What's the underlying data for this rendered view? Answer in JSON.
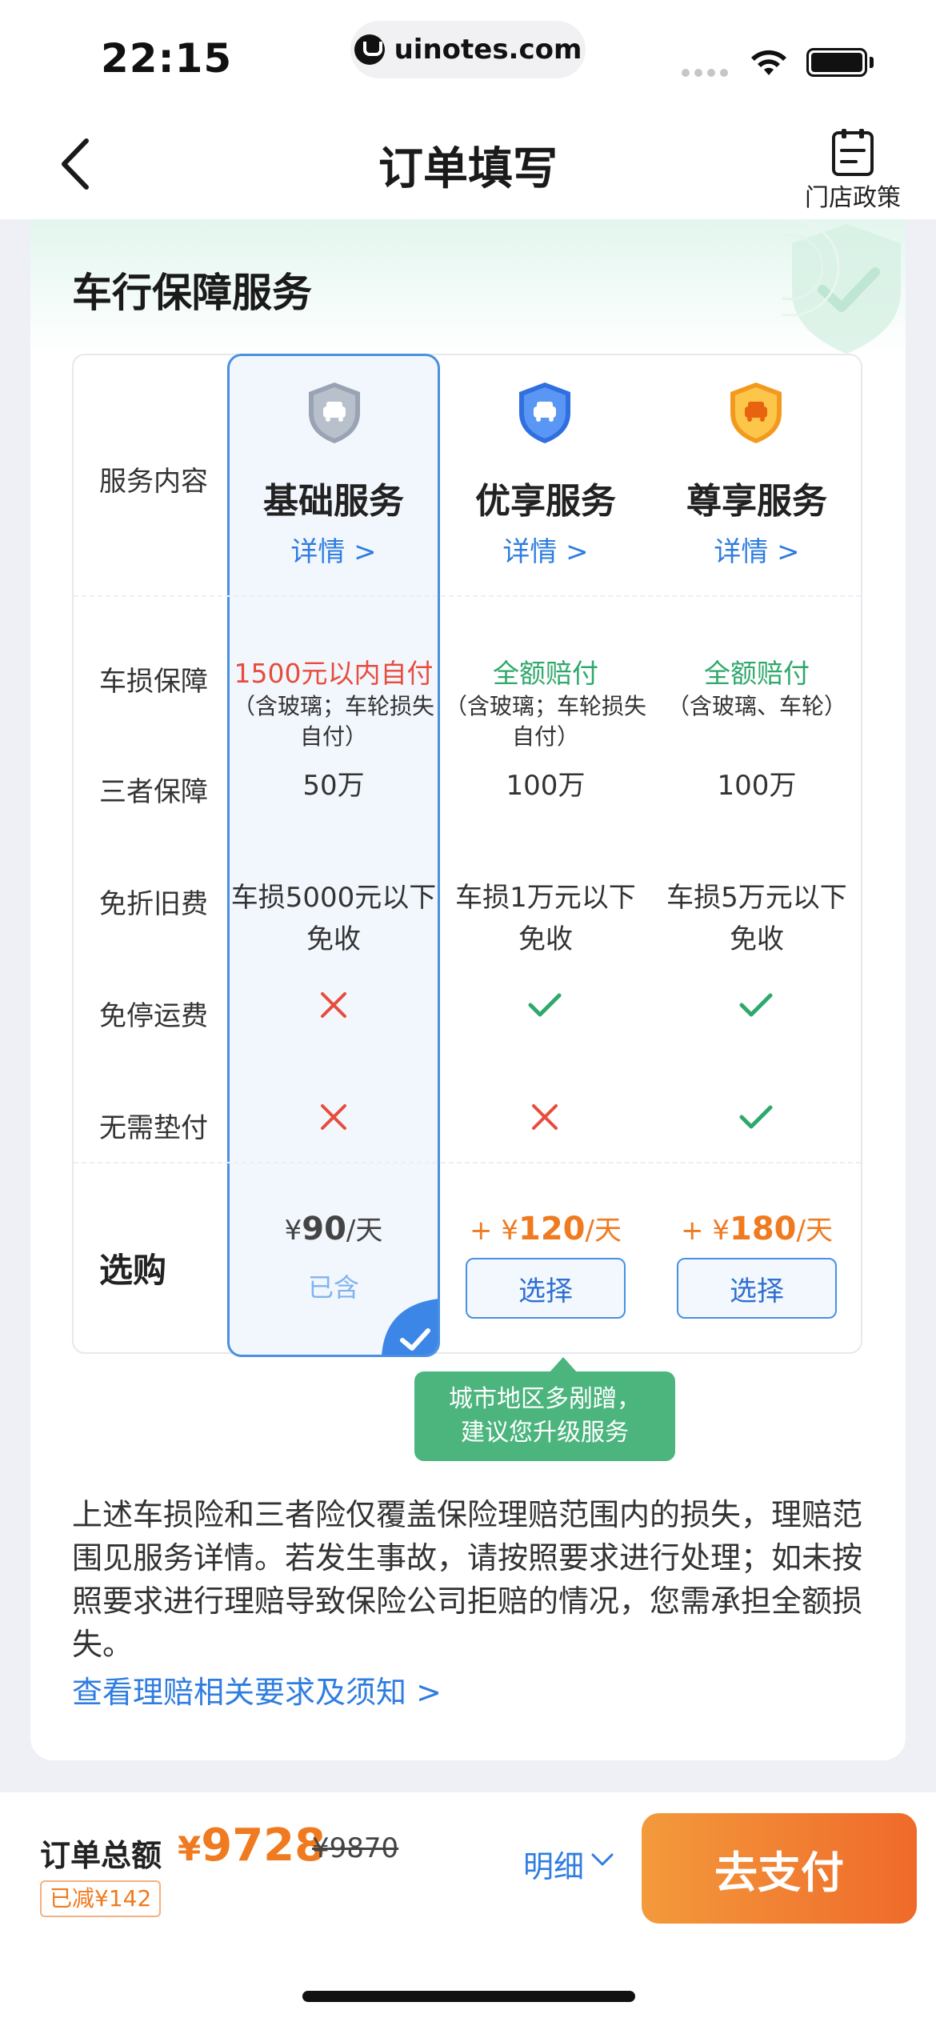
{
  "status_bar": {
    "time": "22:15",
    "url": "uinotes.com",
    "icons": [
      "signal-icon",
      "wifi-icon",
      "battery-icon"
    ]
  },
  "nav": {
    "title": "订单填写",
    "back_icon": "chevron-left-icon",
    "policy_label": "门店政策",
    "policy_icon": "document-icon"
  },
  "card": {
    "title": "车行保障服务",
    "row_labels": {
      "service": "服务内容",
      "damage": "车损保障",
      "third_party": "三者保障",
      "depreciation": "免折旧费",
      "downtime": "免停运费",
      "no_advance": "无需垫付",
      "buy": "选购"
    },
    "plans": [
      {
        "name": "基础服务",
        "detail": "详情 >",
        "shield_color": "#9aa3b3",
        "damage_main": "1500元以内自付",
        "damage_sub": "（含玻璃；车轮损失自付）",
        "third_party": "50万",
        "depreciation": "车损5000元以下免收",
        "downtime": false,
        "no_advance": false,
        "price": "90",
        "price_prefix": "¥",
        "price_unit": "/天",
        "action": "已含",
        "selected": true
      },
      {
        "name": "优享服务",
        "detail": "详情 >",
        "shield_color": "#3d7ff0",
        "damage_main": "全额赔付",
        "damage_sub": "（含玻璃；车轮损失自付）",
        "third_party": "100万",
        "depreciation": "车损1万元以下免收",
        "downtime": true,
        "no_advance": false,
        "price": "120",
        "price_prefix": "+ ¥",
        "price_unit": "/天",
        "action": "选择",
        "selected": false
      },
      {
        "name": "尊享服务",
        "detail": "详情 >",
        "shield_color": "#f6a82b",
        "damage_main": "全额赔付",
        "damage_sub": "（含玻璃、车轮）",
        "third_party": "100万",
        "depreciation": "车损5万元以下免收",
        "downtime": true,
        "no_advance": true,
        "price": "180",
        "price_prefix": "+ ¥",
        "price_unit": "/天",
        "action": "选择",
        "selected": false
      }
    ],
    "tooltip_line1": "城市地区多剐蹭，",
    "tooltip_line2": "建议您升级服务",
    "disclaimer": "上述车损险和三者险仅覆盖保险理赔范围内的损失，理赔范围见服务详情。若发生事故，请按照要求进行处理；如未按照要求进行理赔导致保险公司拒赔的情况，您需承担全额损失。",
    "claim_link": "查看理赔相关要求及须知 >"
  },
  "footer": {
    "total_label": "订单总额",
    "total_currency": "¥",
    "total_amount": "9728",
    "original_price": "¥9870",
    "discount": "已减¥142",
    "detail_label": "明细",
    "pay_label": "去支付"
  },
  "colors": {
    "accent_blue": "#2f7de1",
    "accent_orange": "#f07a1f",
    "success_green": "#2fa86b",
    "error_red": "#e74c3c",
    "tooltip_green": "#4cb57e"
  }
}
